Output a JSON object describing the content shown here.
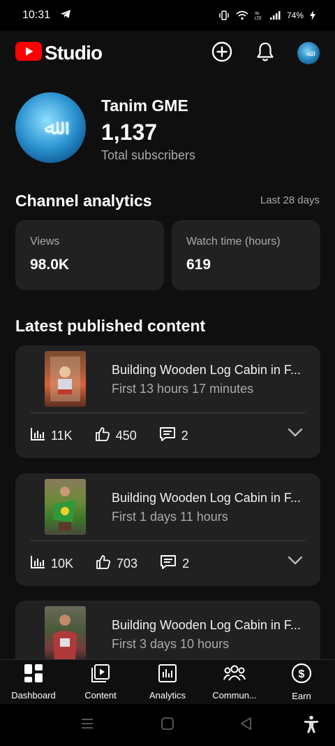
{
  "status_bar": {
    "time": "10:31",
    "battery": "74%"
  },
  "app": {
    "logo_text": "Studio"
  },
  "channel": {
    "name": "Tanim GME",
    "subscribers": "1,137",
    "subscribers_label": "Total subscribers"
  },
  "analytics": {
    "title": "Channel analytics",
    "period": "Last 28 days",
    "metrics": [
      {
        "label": "Views",
        "value": "98.0K"
      },
      {
        "label": "Watch time (hours)",
        "value": "619"
      }
    ]
  },
  "latest": {
    "title": "Latest published content",
    "items": [
      {
        "title": "Building Wooden Log Cabin in F...",
        "subtitle": "First 13 hours 17 minutes",
        "views": "11K",
        "likes": "450",
        "comments": "2"
      },
      {
        "title": "Building Wooden Log Cabin in F...",
        "subtitle": "First 1 days 11 hours",
        "views": "10K",
        "likes": "703",
        "comments": "2"
      },
      {
        "title": "Building Wooden Log Cabin in F...",
        "subtitle": "First 3 days 10 hours"
      }
    ]
  },
  "bottom_nav": [
    {
      "label": "Dashboard",
      "icon": "dashboard-icon"
    },
    {
      "label": "Content",
      "icon": "content-icon"
    },
    {
      "label": "Analytics",
      "icon": "analytics-icon"
    },
    {
      "label": "Commun...",
      "icon": "community-icon"
    },
    {
      "label": "Earn",
      "icon": "earn-icon"
    }
  ],
  "colors": {
    "background": "#0f0f0f",
    "card": "#212121",
    "brand_red": "#ff0000",
    "muted_text": "#aaaaaa"
  }
}
